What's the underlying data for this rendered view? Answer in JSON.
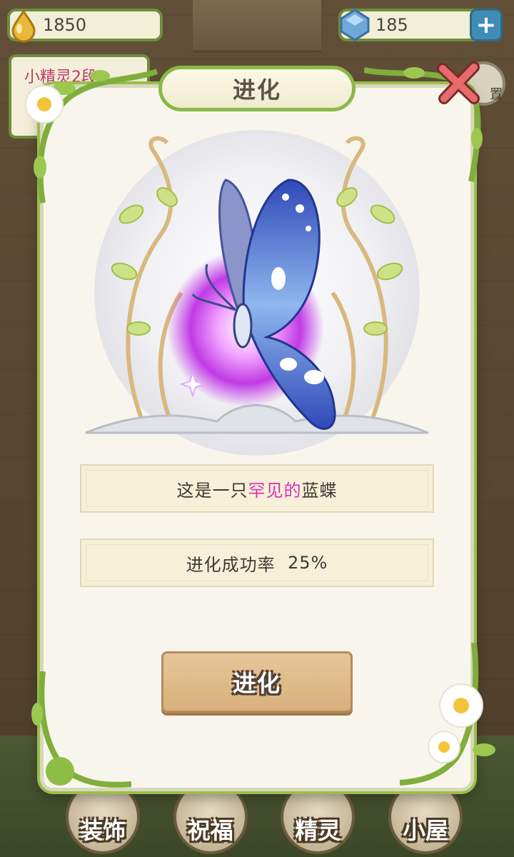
{
  "resources": {
    "gold": "1850",
    "gems": "185"
  },
  "stage_tag": "小精灵2段",
  "settings_label": "置",
  "dialog": {
    "title": "进化",
    "description": {
      "prefix": "这是一只",
      "highlight": "罕见的",
      "suffix": "蓝蝶"
    },
    "success_rate_label": "进化成功率",
    "success_rate_value": "25%",
    "evolve_button": "进化"
  },
  "bottom_nav": [
    "装饰",
    "祝福",
    "精灵",
    "小屋"
  ],
  "colors": {
    "frame_green": "#8ab848",
    "highlight_pink": "#e030b8",
    "button_tan": "#d8b07a",
    "butterfly_blue": "#3a5fcf"
  }
}
